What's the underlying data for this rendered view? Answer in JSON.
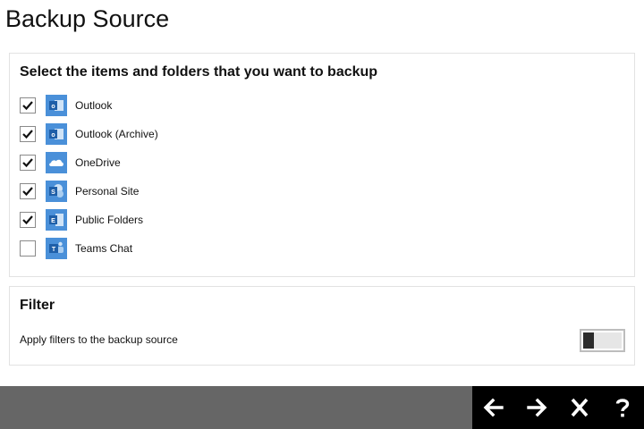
{
  "page": {
    "title": "Backup Source"
  },
  "source": {
    "heading": "Select the items and folders that you want to backup",
    "items": [
      {
        "label": "Outlook",
        "checked": true,
        "icon": "outlook-icon"
      },
      {
        "label": "Outlook (Archive)",
        "checked": true,
        "icon": "outlook-icon"
      },
      {
        "label": "OneDrive",
        "checked": true,
        "icon": "onedrive-icon"
      },
      {
        "label": "Personal Site",
        "checked": true,
        "icon": "sharepoint-icon"
      },
      {
        "label": "Public Folders",
        "checked": true,
        "icon": "exchange-icon"
      },
      {
        "label": "Teams Chat",
        "checked": false,
        "icon": "teams-icon"
      }
    ]
  },
  "filter": {
    "heading": "Filter",
    "label": "Apply filters to the backup source",
    "enabled": false
  },
  "nav": {
    "back_icon": "arrow-left-icon",
    "next_icon": "arrow-right-icon",
    "close_icon": "close-icon",
    "help_icon": "help-icon"
  },
  "colors": {
    "icon_blue": "#4a90d9",
    "bottom_bar": "#666666",
    "nav_bg": "#000000"
  }
}
